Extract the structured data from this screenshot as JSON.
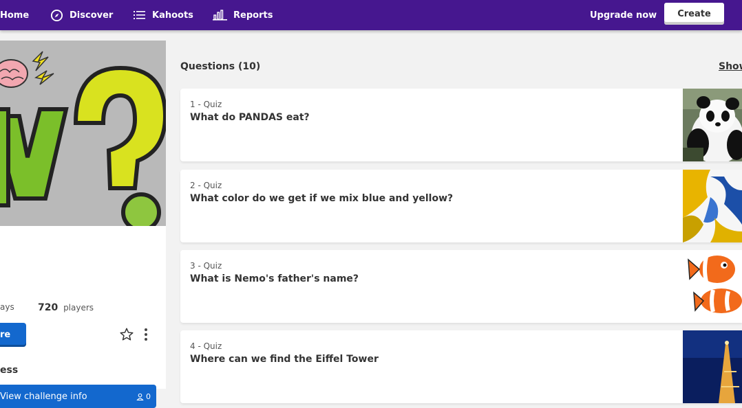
{
  "nav": {
    "home": "Home",
    "discover": "Discover",
    "kahoots": "Kahoots",
    "reports": "Reports",
    "upgrade": "Upgrade now",
    "create": "Create"
  },
  "left": {
    "stat_plays_label": "ays",
    "stat_players_value": "720",
    "stat_players_label": "players",
    "primary_button": "re",
    "section_label": "ess",
    "challenge_button": "View challenge info",
    "challenge_count": "0"
  },
  "questions": {
    "heading": "Questions (10)",
    "show_link": "Show",
    "items": [
      {
        "number": "1 - Quiz",
        "text": "What do PANDAS eat?"
      },
      {
        "number": "2 - Quiz",
        "text": "What color do we get if we mix blue and yellow?"
      },
      {
        "number": "3 - Quiz",
        "text": "What is Nemo's father's name?"
      },
      {
        "number": "4 - Quiz",
        "text": "Where can we find the Eiffel Tower"
      }
    ]
  },
  "colors": {
    "nav_bg": "#46178f",
    "accent_blue": "#1368ce",
    "page_bg": "#f2f2f2"
  }
}
